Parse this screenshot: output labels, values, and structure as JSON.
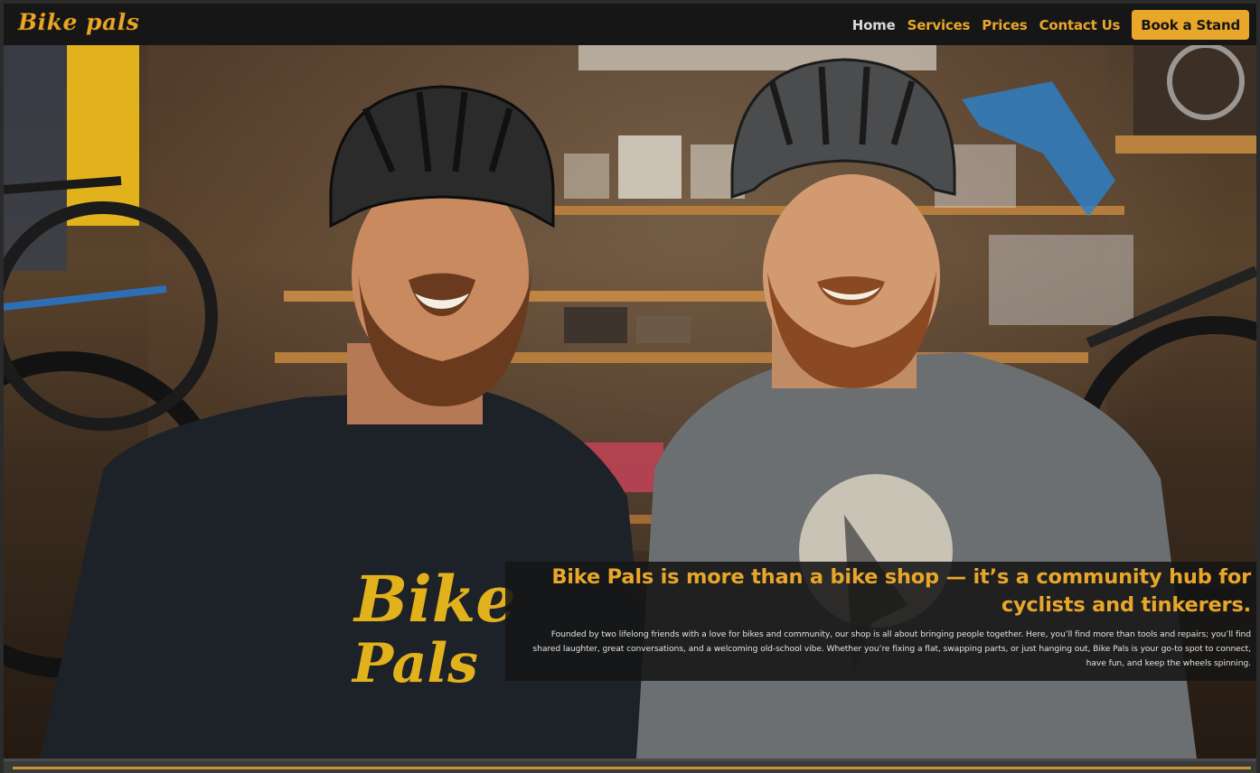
{
  "brand": {
    "logo_text": "Bike pals",
    "accent_color": "#e8a62a"
  },
  "nav": {
    "links": [
      "Home",
      "Services",
      "Prices",
      "Contact Us"
    ],
    "cta_label": "Book a Stand"
  },
  "hero": {
    "headline": "Bike Pals is more than a bike shop — it’s a community hub for cyclists and tinkerers.",
    "body": "Founded by two lifelong friends with a love for bikes and community, our shop is all about bringing people together. Here, you’ll find more than tools and repairs; you’ll find shared laughter, great conversations, and a welcoming old-school vibe. Whether you’re fixing a flat, swapping parts, or just hanging out, Bike Pals is your go-to spot to connect, have fun, and keep the wheels spinning.",
    "shirt_print_line1": "Bike",
    "shirt_print_line2": "Pals"
  }
}
